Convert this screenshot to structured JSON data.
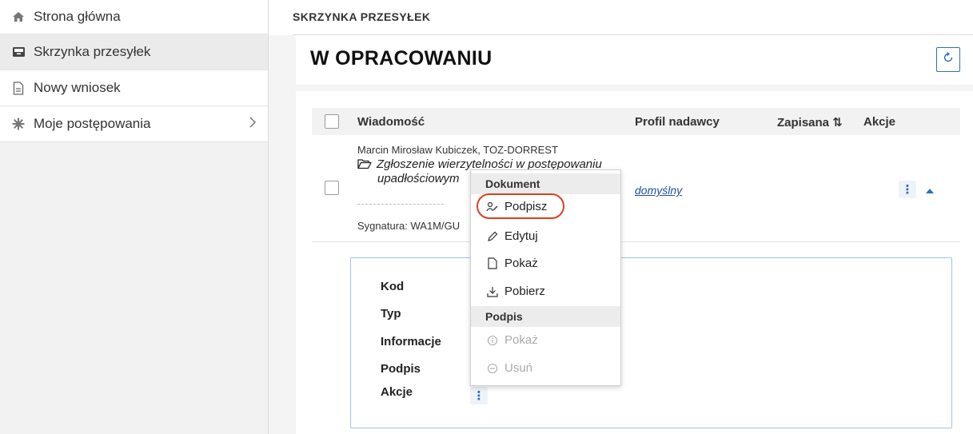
{
  "sidebar": {
    "items": [
      {
        "label": "Strona główna",
        "icon": "home-icon"
      },
      {
        "label": "Skrzynka przesyłek",
        "icon": "inbox-icon"
      },
      {
        "label": "Nowy wniosek",
        "icon": "document-icon"
      },
      {
        "label": "Moje postępowania",
        "icon": "gear-icon"
      }
    ]
  },
  "breadcrumb": "SKRZYNKA PRZESYŁEK",
  "page_title": "W OPRACOWANIU",
  "table": {
    "headers": [
      "Wiadomość",
      "Profil nadawcy",
      "Zapisana ⇅",
      "Akcje"
    ],
    "row": {
      "sender": "Marcin Mirosław Kubiczek, TOZ-DORREST",
      "message_line1": "Zgłoszenie wierzytelności w postępowaniu",
      "message_line2": "upadłościowym",
      "signature": "Sygnatura: WA1M/GU",
      "profile": "domyślny"
    }
  },
  "details": {
    "labels": [
      "Kod",
      "Typ",
      "Informacje",
      "Podpis",
      "Akcje"
    ]
  },
  "menu": {
    "section_document": "Dokument",
    "items_document": [
      "Podpisz",
      "Edytuj",
      "Pokaż",
      "Pobierz"
    ],
    "section_signature": "Podpis",
    "items_signature": [
      "Pokaż",
      "Usuń"
    ]
  },
  "colors": {
    "accent": "#2f6fb5",
    "highlight": "#d9401f",
    "link": "#1b4f9c"
  }
}
